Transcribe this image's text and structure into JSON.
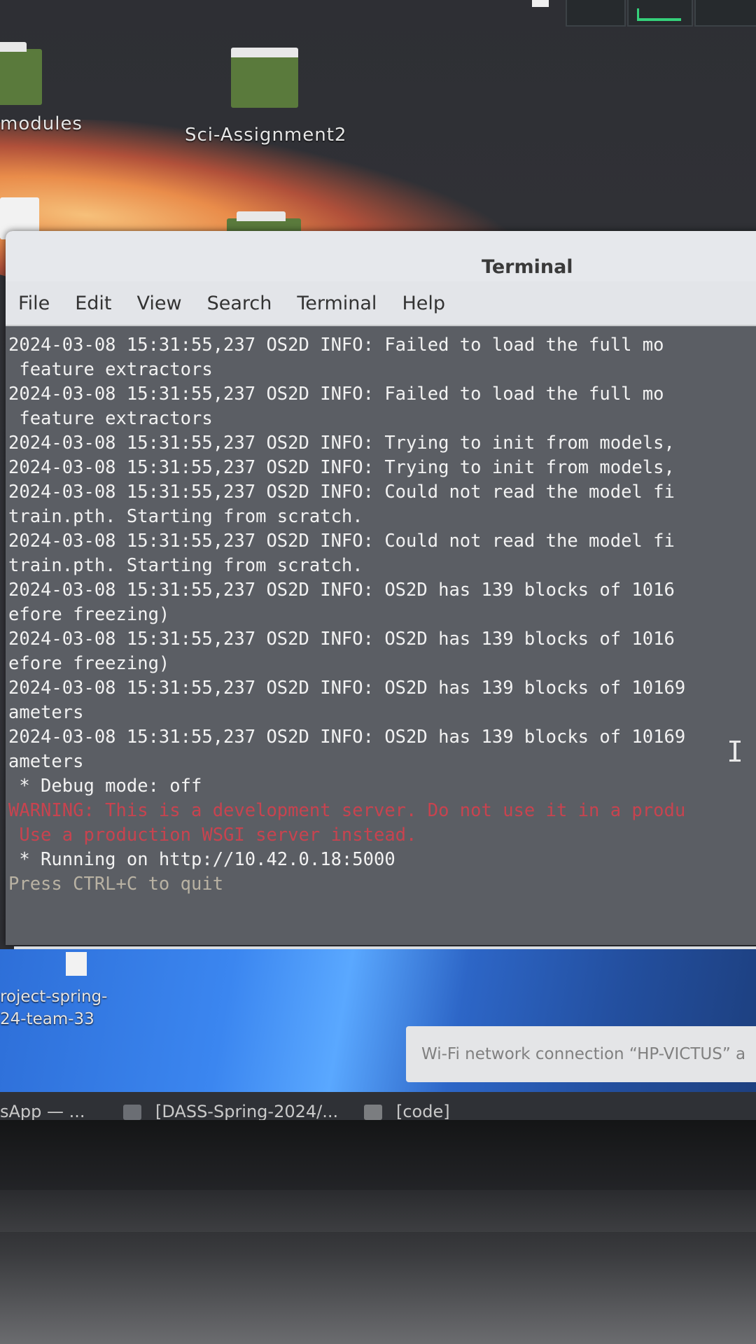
{
  "desktop": {
    "icons": [
      {
        "label": "modules"
      },
      {
        "label": "Sci-Assignment2"
      },
      {
        "label_line1": "roject-spring-",
        "label_line2": "24-team-33"
      }
    ]
  },
  "terminal": {
    "title": "Terminal",
    "menu": [
      "File",
      "Edit",
      "View",
      "Search",
      "Terminal",
      "Help"
    ],
    "lines": [
      {
        "text": "2024-03-08 15:31:55,237 OS2D INFO: Failed to load the full mo",
        "style": "normal"
      },
      {
        "text": " feature extractors",
        "style": "normal"
      },
      {
        "text": "2024-03-08 15:31:55,237 OS2D INFO: Failed to load the full mo",
        "style": "normal"
      },
      {
        "text": " feature extractors",
        "style": "normal"
      },
      {
        "text": "2024-03-08 15:31:55,237 OS2D INFO: Trying to init from models,",
        "style": "normal"
      },
      {
        "text": "2024-03-08 15:31:55,237 OS2D INFO: Trying to init from models,",
        "style": "normal"
      },
      {
        "text": "2024-03-08 15:31:55,237 OS2D INFO: Could not read the model fi",
        "style": "normal"
      },
      {
        "text": "train.pth. Starting from scratch.",
        "style": "normal"
      },
      {
        "text": "2024-03-08 15:31:55,237 OS2D INFO: Could not read the model fi",
        "style": "normal"
      },
      {
        "text": "train.pth. Starting from scratch.",
        "style": "normal"
      },
      {
        "text": "2024-03-08 15:31:55,237 OS2D INFO: OS2D has 139 blocks of 1016",
        "style": "normal"
      },
      {
        "text": "efore freezing)",
        "style": "normal"
      },
      {
        "text": "2024-03-08 15:31:55,237 OS2D INFO: OS2D has 139 blocks of 1016",
        "style": "normal"
      },
      {
        "text": "efore freezing)",
        "style": "normal"
      },
      {
        "text": "2024-03-08 15:31:55,237 OS2D INFO: OS2D has 139 blocks of 10169",
        "style": "normal"
      },
      {
        "text": "ameters",
        "style": "normal"
      },
      {
        "text": "2024-03-08 15:31:55,237 OS2D INFO: OS2D has 139 blocks of 10169",
        "style": "normal"
      },
      {
        "text": "ameters",
        "style": "normal"
      },
      {
        "text": " * Debug mode: off",
        "style": "normal"
      },
      {
        "text": "WARNING: This is a development server. Do not use it in a produ",
        "style": "warn"
      },
      {
        "text": " Use a production WSGI server instead.",
        "style": "warn"
      },
      {
        "text": " * Running on http://10.42.0.18:5000",
        "style": "normal"
      },
      {
        "text": "Press CTRL+C to quit",
        "style": "dim"
      }
    ]
  },
  "notification": {
    "text": "Wi-Fi network connection “HP-VICTUS” a"
  },
  "taskbar": {
    "items": [
      "sApp — ...",
      "[DASS-Spring-2024/...",
      "[code]"
    ]
  }
}
